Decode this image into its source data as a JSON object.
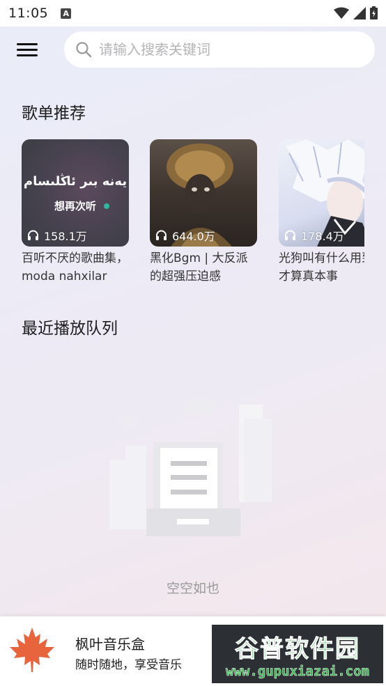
{
  "status_bar": {
    "time": "11:05",
    "notification_badge": "A"
  },
  "search": {
    "placeholder": "请输入搜索关键词"
  },
  "sections": {
    "recommended_title": "歌单推荐",
    "recent_title": "最近播放队列"
  },
  "playlists": [
    {
      "name": "百听不厌的歌曲集，moda nahxilar",
      "play_count": "158.1万",
      "cover_text": "يەنە بىر ئاڭلىسام",
      "cover_subtext": "想再次听",
      "icon": "headphones-icon"
    },
    {
      "name": "黑化Bgm | 大反派的超强压迫感",
      "play_count": "644.0万",
      "icon": "headphones-icon"
    },
    {
      "name": "光狗叫有什么用到我才算真本事",
      "play_count": "178.4万",
      "icon": "headphones-icon"
    }
  ],
  "empty_state": {
    "text": "空空如也"
  },
  "player": {
    "title": "枫叶音乐盒",
    "subtitle": "随时随地，享受音乐"
  },
  "watermark": {
    "title": "谷普软件园",
    "url": "www.gupuxiazai.com"
  },
  "colors": {
    "accent_logo": "#e8643c",
    "watermark_green": "#36b34a"
  }
}
